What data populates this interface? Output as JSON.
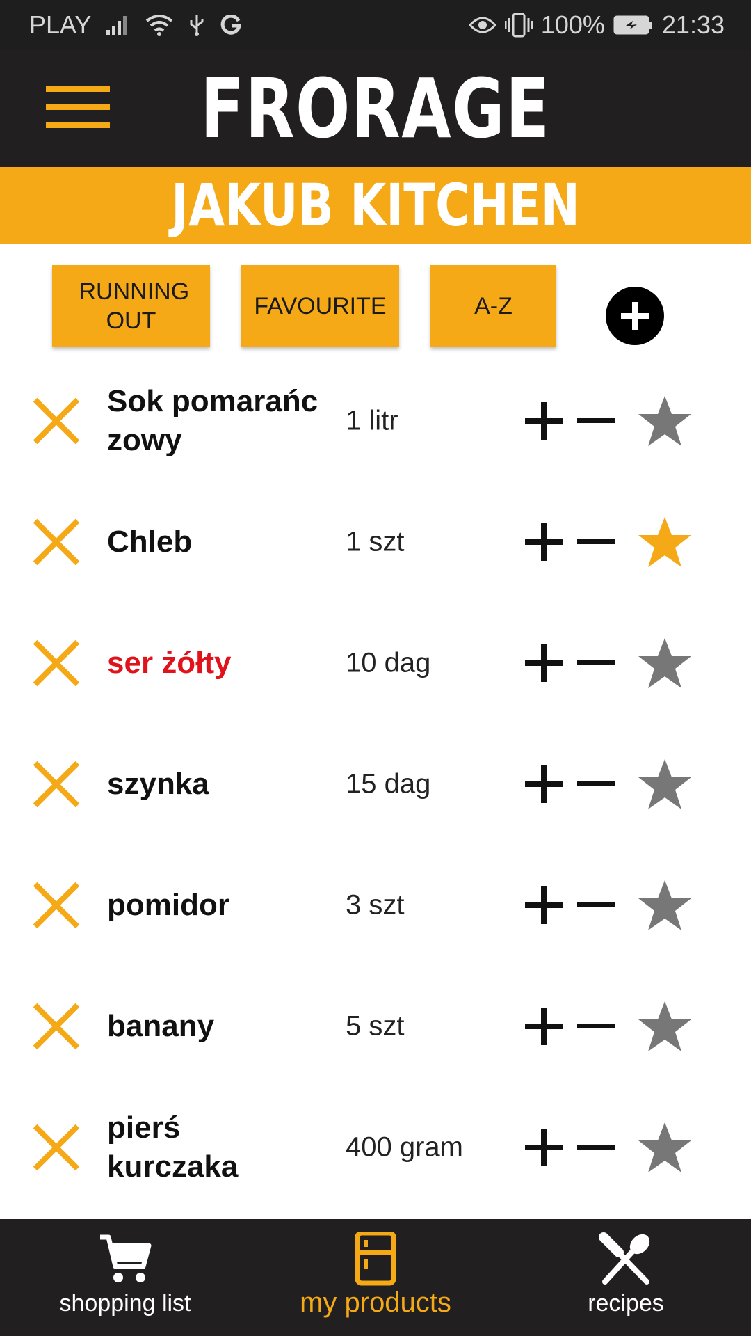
{
  "status_bar": {
    "carrier": "PLAY",
    "battery": "100%",
    "time": "21:33"
  },
  "app_bar": {
    "title": "FRORAGE"
  },
  "kitchen": {
    "name": "JAKUB KITCHEN"
  },
  "filters": {
    "running_out": "RUNNING OUT",
    "favourite": "FAVOURITE",
    "az": "A-Z"
  },
  "colors": {
    "accent": "#f5a917",
    "dark": "#211f20",
    "low_stock": "#e0131b",
    "star_inactive": "#777777"
  },
  "products": [
    {
      "name": "Sok pomarańc zowy",
      "qty": "1 litr",
      "favourite": false,
      "low": false
    },
    {
      "name": "Chleb",
      "qty": "1 szt",
      "favourite": true,
      "low": false
    },
    {
      "name": "ser żółty",
      "qty": "10 dag",
      "favourite": false,
      "low": true
    },
    {
      "name": "szynka",
      "qty": "15 dag",
      "favourite": false,
      "low": false
    },
    {
      "name": "pomidor",
      "qty": "3 szt",
      "favourite": false,
      "low": false
    },
    {
      "name": "banany",
      "qty": "5 szt",
      "favourite": false,
      "low": false
    },
    {
      "name": "pierś kurczaka",
      "qty": "400 gram",
      "favourite": false,
      "low": false
    }
  ],
  "bottom_nav": {
    "shopping_list": "shopping list",
    "my_products": "my products",
    "recipes": "recipes",
    "active": "my_products"
  }
}
